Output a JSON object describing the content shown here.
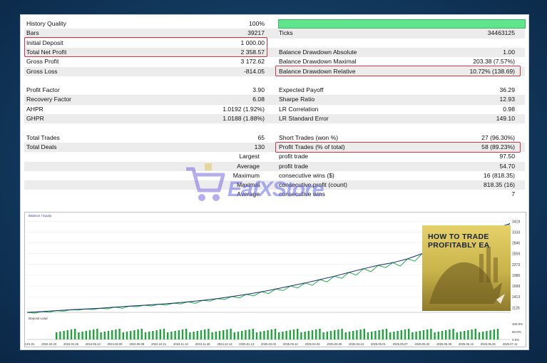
{
  "left_rows": [
    {
      "label": "History Quality",
      "value": "100%"
    },
    {
      "label": "Bars",
      "value": "39217"
    },
    {
      "label": "Initial Deposit",
      "value": "1 000.00"
    },
    {
      "label": "Total Net Profit",
      "value": "2 358.57"
    },
    {
      "label": "Gross Profit",
      "value": "3 172.62"
    },
    {
      "label": "Gross Loss",
      "value": "-814.05"
    },
    {
      "label": "",
      "value": ""
    },
    {
      "label": "Profit Factor",
      "value": "3.90"
    },
    {
      "label": "Recovery Factor",
      "value": "6.08"
    },
    {
      "label": "AHPR",
      "value": "1.0192 (1.92%)"
    },
    {
      "label": "GHPR",
      "value": "1.0188 (1.88%)"
    },
    {
      "label": "",
      "value": ""
    },
    {
      "label": "Total Trades",
      "value": "65"
    },
    {
      "label": "Total Deals",
      "value": "130"
    },
    {
      "label": "Largest",
      "value": ""
    },
    {
      "label": "Average",
      "value": ""
    },
    {
      "label": "Maximum",
      "value": ""
    },
    {
      "label": "Maximal",
      "value": ""
    },
    {
      "label": "Average",
      "value": ""
    }
  ],
  "right_rows": [
    {
      "label": "",
      "value": ""
    },
    {
      "label": "Ticks",
      "value": "34463125"
    },
    {
      "label": "",
      "value": ""
    },
    {
      "label": "Balance Drawdown Absolute",
      "value": "1.00"
    },
    {
      "label": "Balance Drawdown Maximal",
      "value": "203.38 (7.57%)"
    },
    {
      "label": "Balance Drawdown Relative",
      "value": "10.72% (138.69)"
    },
    {
      "label": "",
      "value": ""
    },
    {
      "label": "Expected Payoff",
      "value": "36.29"
    },
    {
      "label": "Sharpe Ratio",
      "value": "12.93"
    },
    {
      "label": "LR Correlation",
      "value": "0.98"
    },
    {
      "label": "LR Standard Error",
      "value": "149.10"
    },
    {
      "label": "",
      "value": ""
    },
    {
      "label": "Short Trades (won %)",
      "value": "27 (96.30%)"
    },
    {
      "label": "Profit Trades (% of total)",
      "value": "58 (89.23%)"
    },
    {
      "label": "profit trade",
      "value": "97.50"
    },
    {
      "label": "profit trade",
      "value": "54.70"
    },
    {
      "label": "consecutive wins ($)",
      "value": "16 (818.35)"
    },
    {
      "label": "consecutive profit (count)",
      "value": "818.35 (16)"
    },
    {
      "label": "consecutive wins",
      "value": "7"
    }
  ],
  "history_quality_fill": 1.0,
  "watermark_text": "EafXStore",
  "thumbnail_title": "HOW TO TRADE PROFITABLY EA",
  "colors": {
    "highlight": "#d2344a",
    "quality_bar": "#5fe68c",
    "balance": "#1a2f6b",
    "equity": "#22b14c",
    "load_bar": "#1fa53a"
  },
  "chart_data": {
    "type": "line",
    "legend": "Balance / Equity",
    "y_ticks": [
      "3419",
      "3133",
      "2846",
      "2559",
      "2273",
      "1986",
      "1699",
      "1413",
      "1126"
    ],
    "load_label": "Deposit Load",
    "load_ticks": [
      "100.0%",
      "50.0%",
      "0.0%"
    ],
    "x_ticks": [
      "2024.01.01",
      "2024.02.23",
      "2024.04.26",
      "2024.06.24",
      "2024.08.08",
      "2024.09.08",
      "2024.10.21",
      "2024.11.13",
      "2024.11.28",
      "2024.12.13",
      "2025.01.13",
      "2025.02.03",
      "2025.03.12",
      "2025.04.03",
      "2025.04.09",
      "2025.04.24",
      "2025.05.01",
      "2025.05.07",
      "2025.05.22",
      "2025.06.06",
      "2025.06.13",
      "2025.06.26",
      "2025.07.11"
    ],
    "balance": [
      1000,
      1020,
      1045,
      1070,
      1090,
      1110,
      1140,
      1165,
      1190,
      1215,
      1245,
      1280,
      1320,
      1365,
      1420,
      1480,
      1545,
      1620,
      1700,
      1780,
      1870,
      1960,
      2060,
      2160,
      2250,
      2320,
      2420,
      2560,
      2680,
      2820,
      2960,
      3080,
      3220,
      3358
    ],
    "equity_dips": [
      980,
      1005,
      1030,
      1060,
      1075,
      1095,
      1110,
      1150,
      1170,
      1195,
      1225,
      1240,
      1300,
      1340,
      1385,
      1440,
      1500,
      1580,
      1650,
      1720,
      1810,
      1905,
      1990,
      2080,
      2190,
      2230,
      2360,
      2480,
      2620,
      2740,
      2880,
      3020,
      3160,
      3358
    ]
  }
}
